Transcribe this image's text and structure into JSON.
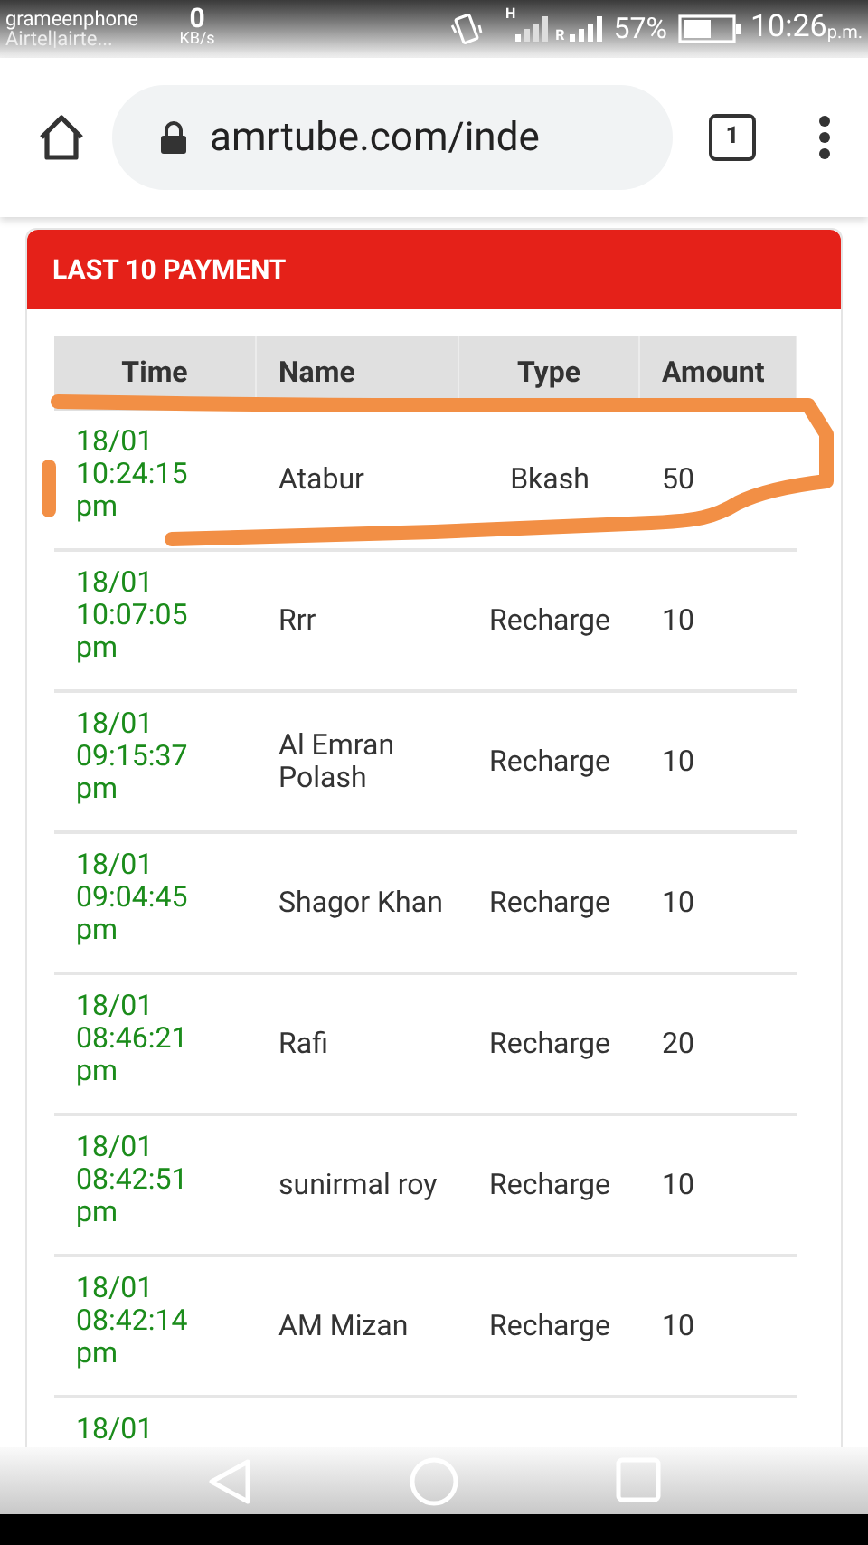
{
  "status_bar": {
    "carrier_1": "grameenphone",
    "carrier_2": "Airtel|airte...",
    "speed_value": "0",
    "speed_unit": "KB/s",
    "network_label": "H",
    "roaming_label": "R",
    "battery": "57%",
    "time": "10:26",
    "time_suffix": "p.m."
  },
  "browser": {
    "url": "amrtube.com/inde",
    "tab_count": "1"
  },
  "card": {
    "title": "LAST 10 PAYMENT"
  },
  "table": {
    "columns": [
      "Time",
      "Name",
      "Type",
      "Amount"
    ],
    "rows": [
      {
        "time": [
          "18/01",
          "10:24:15",
          "pm"
        ],
        "name": "Atabur",
        "type": "Bkash",
        "amount": "50"
      },
      {
        "time": [
          "18/01",
          "10:07:05",
          "pm"
        ],
        "name": "Rrr",
        "type": "Recharge",
        "amount": "10"
      },
      {
        "time": [
          "18/01",
          "09:15:37",
          "pm"
        ],
        "name": "Al Emran Polash",
        "type": "Recharge",
        "amount": "10"
      },
      {
        "time": [
          "18/01",
          "09:04:45",
          "pm"
        ],
        "name": "Shagor Khan",
        "type": "Recharge",
        "amount": "10"
      },
      {
        "time": [
          "18/01",
          "08:46:21",
          "pm"
        ],
        "name": "Rafi",
        "type": "Recharge",
        "amount": "20"
      },
      {
        "time": [
          "18/01",
          "08:42:51",
          "pm"
        ],
        "name": "sunirmal roy",
        "type": "Recharge",
        "amount": "10"
      },
      {
        "time": [
          "18/01",
          "08:42:14",
          "pm"
        ],
        "name": "AM Mizan",
        "type": "Recharge",
        "amount": "10"
      },
      {
        "time": [
          "18/01"
        ],
        "name": "",
        "type": "",
        "amount": ""
      }
    ]
  }
}
